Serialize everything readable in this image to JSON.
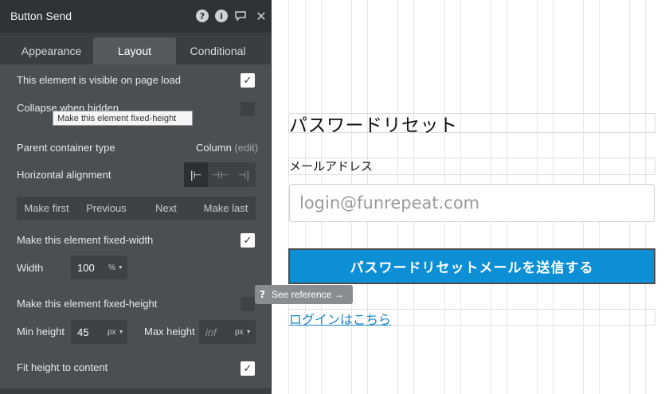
{
  "panel": {
    "title": "Button Send",
    "header_icons": [
      "question-icon",
      "info-icon",
      "comment-icon",
      "close-icon"
    ],
    "tabs": [
      {
        "label": "Appearance"
      },
      {
        "label": "Layout"
      },
      {
        "label": "Conditional"
      }
    ],
    "active_tab": "Layout",
    "visible_on_load": {
      "label": "This element is visible on page load",
      "checked": true
    },
    "collapse_when_hidden": {
      "label": "Collapse when hidden",
      "checked": false
    },
    "tooltip": "Make this element fixed-height",
    "parent_container": {
      "label": "Parent container type",
      "value": "Column",
      "edit": "(edit)"
    },
    "horizontal_alignment": {
      "label": "Horizontal alignment",
      "options": [
        "align-left-icon",
        "align-center-icon",
        "align-right-icon"
      ],
      "selected": "align-left-icon"
    },
    "order_buttons": [
      "Make first",
      "Previous",
      "Next",
      "Make last"
    ],
    "fixed_width": {
      "label": "Make this element fixed-width",
      "checked": true
    },
    "width": {
      "label": "Width",
      "value": "100",
      "unit": "%"
    },
    "fixed_height": {
      "label": "Make this element fixed-height",
      "checked": false
    },
    "min_height": {
      "label": "Min height",
      "value": "45",
      "unit": "px"
    },
    "max_height": {
      "label": "Max height",
      "placeholder": "inf",
      "unit": "px"
    },
    "fit_height": {
      "label": "Fit height to content",
      "checked": true
    },
    "see_reference": {
      "q": "?",
      "label": "See reference →"
    }
  },
  "canvas": {
    "page_title": "パスワードリセット",
    "email_label": "メールアドレス",
    "email_placeholder": "login@funrepeat.com",
    "send_button": "パスワードリセットメールを送信する",
    "login_link": "ログインはこちら"
  },
  "colors": {
    "panel_bg": "#4a4f53",
    "header_bg": "#2f3336",
    "button_blue": "#0d8fd6",
    "link_blue": "#1a86c8"
  }
}
